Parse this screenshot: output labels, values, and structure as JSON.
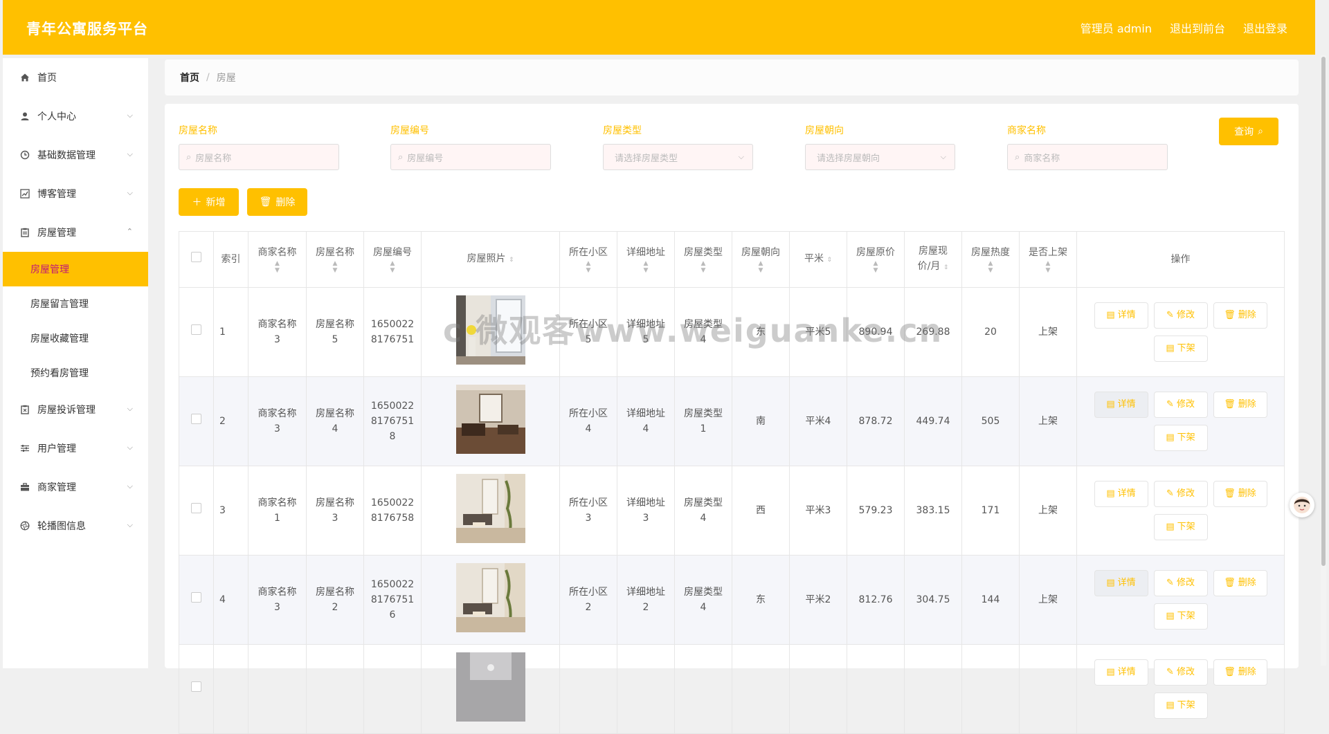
{
  "header": {
    "app_title": "青年公寓服务平台",
    "admin_label": "管理员 admin",
    "to_front_label": "退出到前台",
    "logout_label": "退出登录"
  },
  "sidebar": {
    "items": [
      {
        "label": "首页",
        "icon": "home-icon"
      },
      {
        "label": "个人中心",
        "icon": "user-icon"
      },
      {
        "label": "基础数据管理",
        "icon": "clock-icon"
      },
      {
        "label": "博客管理",
        "icon": "chart-icon"
      },
      {
        "label": "房屋管理",
        "icon": "clipboard-icon"
      },
      {
        "label": "房屋投诉管理",
        "icon": "clipboard-x-icon"
      },
      {
        "label": "用户管理",
        "icon": "sliders-icon"
      },
      {
        "label": "商家管理",
        "icon": "briefcase-icon"
      },
      {
        "label": "轮播图信息",
        "icon": "aperture-icon"
      }
    ],
    "house_sub": [
      "房屋管理",
      "房屋留言管理",
      "房屋收藏管理",
      "预约看房管理"
    ]
  },
  "breadcrumb": {
    "home": "首页",
    "separator": "/",
    "current": "房屋"
  },
  "filters": {
    "name": {
      "label": "房屋名称",
      "placeholder": "房屋名称"
    },
    "code": {
      "label": "房屋编号",
      "placeholder": "房屋编号"
    },
    "type": {
      "label": "房屋类型",
      "placeholder": "请选择房屋类型"
    },
    "orient": {
      "label": "房屋朝向",
      "placeholder": "请选择房屋朝向"
    },
    "merchant": {
      "label": "商家名称",
      "placeholder": "商家名称"
    }
  },
  "buttons": {
    "query": "查询",
    "add": "新增",
    "delete": "删除"
  },
  "table": {
    "headers": {
      "index": "索引",
      "merchant": [
        "商家名称"
      ],
      "name": [
        "房屋名称"
      ],
      "code": [
        "房屋编号"
      ],
      "photo": "房屋照片",
      "community": [
        "所在小区"
      ],
      "address": [
        "详细地址"
      ],
      "type": [
        "房屋类型"
      ],
      "orient": [
        "房屋朝向"
      ],
      "area": "平米",
      "orig_price": [
        "房屋原价"
      ],
      "price": [
        "房屋现",
        "价/月"
      ],
      "heat": [
        "房屋热度"
      ],
      "listed": [
        "是否上架"
      ],
      "ops": "操作"
    },
    "ops_labels": {
      "detail": "详情",
      "edit": "修改",
      "delete": "删除",
      "unlist": "下架"
    },
    "rows": [
      {
        "index": "1",
        "merchant": [
          "商家名称",
          "3"
        ],
        "name": [
          "房屋名称",
          "5"
        ],
        "code": [
          "1650022",
          "8176751"
        ],
        "community": [
          "所在小区",
          "5"
        ],
        "address": [
          "详细地址",
          "5"
        ],
        "type": [
          "房屋类型",
          "4"
        ],
        "orient": "东",
        "area": "平米5",
        "orig_price": "890.94",
        "price": "269.88",
        "heat": "20",
        "listed": "上架",
        "photo": "room-white-window"
      },
      {
        "index": "2",
        "merchant": [
          "商家名称",
          "3"
        ],
        "name": [
          "房屋名称",
          "4"
        ],
        "code": [
          "1650022",
          "8176751",
          "8"
        ],
        "community": [
          "所在小区",
          "4"
        ],
        "address": [
          "详细地址",
          "4"
        ],
        "type": [
          "房屋类型",
          "1"
        ],
        "orient": "南",
        "area": "平米4",
        "orig_price": "878.72",
        "price": "449.74",
        "heat": "505",
        "listed": "上架",
        "photo": "room-brown-living"
      },
      {
        "index": "3",
        "merchant": [
          "商家名称",
          "1"
        ],
        "name": [
          "房屋名称",
          "3"
        ],
        "code": [
          "1650022",
          "8176758"
        ],
        "community": [
          "所在小区",
          "3"
        ],
        "address": [
          "详细地址",
          "3"
        ],
        "type": [
          "房屋类型",
          "4"
        ],
        "orient": "西",
        "area": "平米3",
        "orig_price": "579.23",
        "price": "383.15",
        "heat": "171",
        "listed": "上架",
        "photo": "room-beige-living"
      },
      {
        "index": "4",
        "merchant": [
          "商家名称",
          "3"
        ],
        "name": [
          "房屋名称",
          "2"
        ],
        "code": [
          "1650022",
          "8176751",
          "6"
        ],
        "community": [
          "所在小区",
          "2"
        ],
        "address": [
          "详细地址",
          "2"
        ],
        "type": [
          "房屋类型",
          "4"
        ],
        "orient": "东",
        "area": "平米2",
        "orig_price": "812.76",
        "price": "304.75",
        "heat": "144",
        "listed": "上架",
        "photo": "room-beige-living"
      },
      {
        "index": "",
        "merchant": [],
        "name": [],
        "code": [],
        "community": [],
        "address": [],
        "type": [],
        "orient": "",
        "area": "",
        "orig_price": "",
        "price": "",
        "heat": "",
        "listed": "",
        "photo": "room-ceiling"
      }
    ]
  },
  "watermark": "c 微观客www.weiguanke.cn"
}
